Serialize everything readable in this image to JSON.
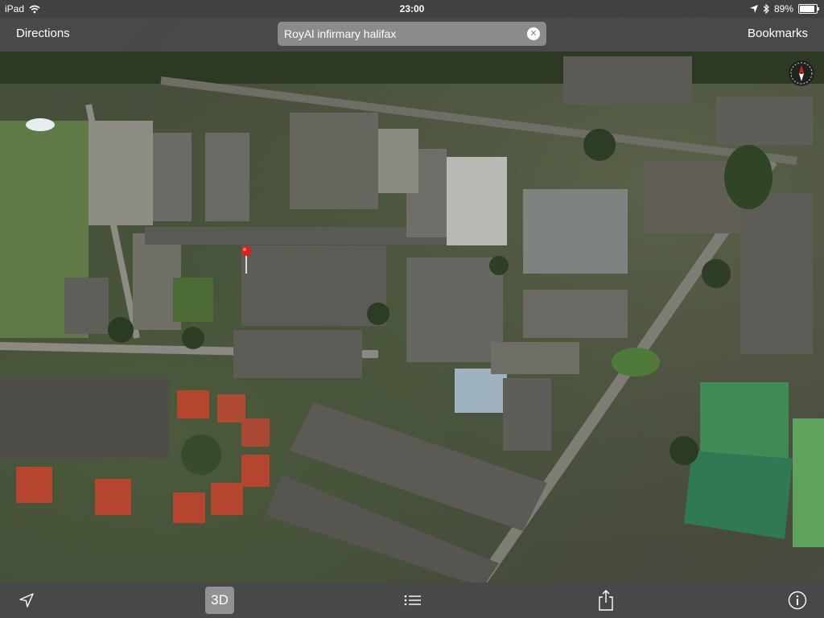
{
  "status_bar": {
    "device": "iPad",
    "time": "23:00",
    "battery_percent": "89%",
    "battery_level": 0.89
  },
  "nav_bar": {
    "left_button": "Directions",
    "search_text": "RoyAl infirmary halifax",
    "right_button": "Bookmarks"
  },
  "map": {
    "view": "satellite-flyover",
    "pin_icon": "red-pin-icon",
    "compass_icon": "compass-icon"
  },
  "toolbar": {
    "location_icon": "location-arrow-icon",
    "mode_button": "3D",
    "list_icon": "list-icon",
    "share_icon": "share-icon",
    "info_icon": "info-icon"
  },
  "colors": {
    "bar_bg": "#48484a",
    "pin_red": "#e0201b",
    "roof_red": "#b5452f",
    "court_green": "#2f7a55"
  }
}
